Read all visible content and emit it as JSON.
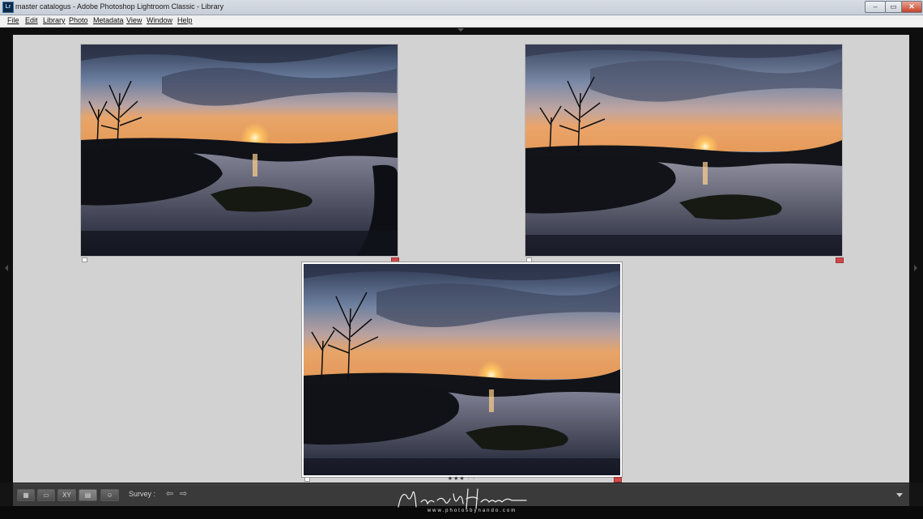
{
  "window": {
    "app_icon": "Lr",
    "title": "master catalogus - Adobe Photoshop Lightroom Classic - Library",
    "controls": {
      "minimize": "–",
      "maximize": "▭",
      "close": "✕"
    }
  },
  "menu": [
    "File",
    "Edit",
    "Library",
    "Photo",
    "Metadata",
    "View",
    "Window",
    "Help"
  ],
  "survey": {
    "photos": [
      {
        "id": "photo-1",
        "selected": false,
        "flag_icon": "flag-marker",
        "color_label": "#d0494a",
        "rating": ""
      },
      {
        "id": "photo-2",
        "selected": false,
        "flag_icon": "flag-marker",
        "color_label": "#d0494a",
        "rating": ""
      },
      {
        "id": "photo-3",
        "selected": true,
        "flag_icon": "flag-marker",
        "color_label": "#d0494a",
        "rating": "★★★ · ·"
      }
    ]
  },
  "toolbar": {
    "view_buttons": [
      {
        "name": "grid-view-icon",
        "glyph": "▦"
      },
      {
        "name": "loupe-view-icon",
        "glyph": "▭"
      },
      {
        "name": "compare-view-icon",
        "glyph": "XY"
      },
      {
        "name": "survey-view-icon",
        "glyph": "▤"
      },
      {
        "name": "people-view-icon",
        "glyph": "☺"
      }
    ],
    "mode_label": "Survey :",
    "prev_arrow": "⇦",
    "next_arrow": "⇨"
  },
  "watermark": {
    "signature": "Nando Harmsen",
    "url": "www.photosbynando.com"
  },
  "colors": {
    "survey_background": "#d2d2d2",
    "toolbar_background": "#3a3a3a",
    "color_label_red": "#d0494a"
  }
}
